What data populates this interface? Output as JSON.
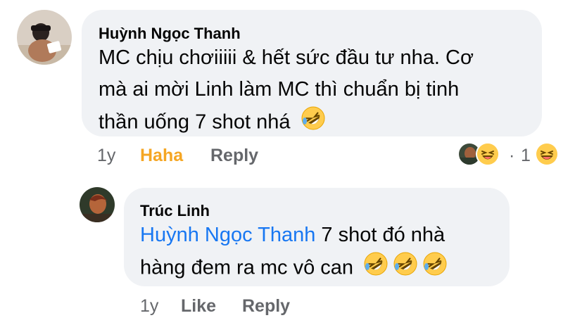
{
  "comment1": {
    "author": "Huỳnh Ngọc Thanh",
    "text_lines": [
      "MC chịu chơiiiii & hết sức đầu tư nha. Cơ",
      "mà ai mời Linh làm MC thì chuẩn bị tinh",
      "thần uống 7 shot nhá"
    ],
    "time": "1y",
    "reaction_label": "Haha",
    "reply_label": "Reply",
    "reaction_count_separator": "·",
    "reaction_count": "1",
    "colors": {
      "reaction_active": "#f5a623"
    }
  },
  "comment2": {
    "author": "Trúc Linh",
    "mention": "Huỳnh Ngọc Thanh",
    "text_line1_rest": " 7 shot đó nhà",
    "text_line2": "hàng đem ra mc vô can",
    "time": "1y",
    "like_label": "Like",
    "reply_label": "Reply"
  },
  "icons": {
    "laughing_emoji": "rolling-on-floor-laughing",
    "haha_reaction": "grinning-squinting-face"
  },
  "colors": {
    "bubble_bg": "#f0f2f5",
    "mention": "#1877f2",
    "meta_text": "#65676b"
  }
}
